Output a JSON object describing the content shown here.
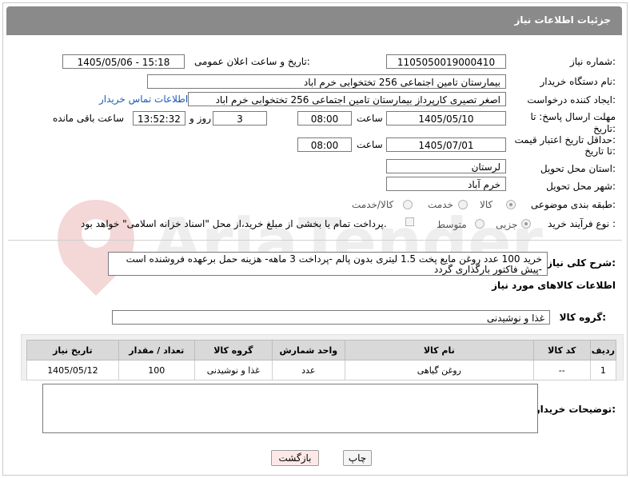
{
  "header": {
    "title": "جزئیات اطلاعات نیاز"
  },
  "fields": {
    "need_number_label": "شماره نیاز:",
    "need_number": "1105050019000410",
    "announce_label": "تاریخ و ساعت اعلان عمومی:",
    "announce_value": "1405/05/06 - 15:18",
    "buyer_org_label": "نام دستگاه خریدار:",
    "buyer_org": "بیمارستان تامین اجتماعی  256 تختخوابی خرم اباد",
    "creator_label": "ایجاد کننده درخواست:",
    "creator": "اصغر تصیری کارپرداز بیمارستان تامین اجتماعی  256 تختخوابی خرم اباد",
    "contact_link": "اطلاعات تماس خریدار",
    "deadline_label_1": "مهلت ارسال پاسخ: تا",
    "deadline_label_2": "تاریخ:",
    "deadline_date": "1405/05/10",
    "time_label": "ساعت",
    "deadline_time": "08:00",
    "days_value": "3",
    "days_label": "روز و",
    "remaining_time": "13:52:32",
    "remaining_label": "ساعت باقی مانده",
    "price_valid_label_1": "حداقل تاریخ اعتبار قیمت:",
    "price_valid_label_2": "تا تاریخ:",
    "price_valid_date": "1405/07/01",
    "price_valid_time": "08:00",
    "province_label": "استان محل تحویل:",
    "province": "لرستان",
    "city_label": "شهر محل تحویل:",
    "city": "خرم آباد",
    "category_label": "طبقه بندی موضوعی:",
    "category_options": [
      "کالا",
      "خدمت",
      "کالا/خدمت"
    ],
    "category_selected": "کالا",
    "purchase_type_label": "نوع فرآیند خرید :",
    "purchase_options": [
      "جزیی",
      "متوسط"
    ],
    "purchase_selected": "جزیی",
    "payment_note": "پرداخت تمام یا بخشی از مبلغ خرید،از محل \"اسناد خزانه اسلامی\" خواهد بود."
  },
  "description": {
    "label": "شرح کلی نیاز:",
    "text": "خرید 100 عدد روغن مایع پخت 1.5 لیتری بدون پالم -پرداخت 3 ماهه- هزینه حمل برعهده فروشنده است -پیش فاکتور بارگذاری گردد"
  },
  "goods": {
    "section_title": "اطلاعات کالاهای مورد نیاز",
    "group_label": "گروه کالا:",
    "group_value": "غذا و نوشیدنی",
    "columns": [
      "ردیف",
      "کد کالا",
      "نام کالا",
      "واحد شمارش",
      "گروه کالا",
      "تعداد / مقدار",
      "تاریخ نیاز"
    ],
    "rows": [
      [
        "1",
        "--",
        "روغن گیاهی",
        "عدد",
        "غذا و نوشیدنی",
        "100",
        "1405/05/12"
      ]
    ]
  },
  "buyer_notes": {
    "label": "توضیحات خریدار:",
    "text": ""
  },
  "buttons": {
    "print": "چاپ",
    "back": "بازگشت"
  },
  "watermark": {
    "text": "AriaTender.net"
  },
  "colors": {
    "titlebar": "#8a8a8a",
    "link": "#1a5bb8",
    "back_button": "#fde8e8"
  }
}
